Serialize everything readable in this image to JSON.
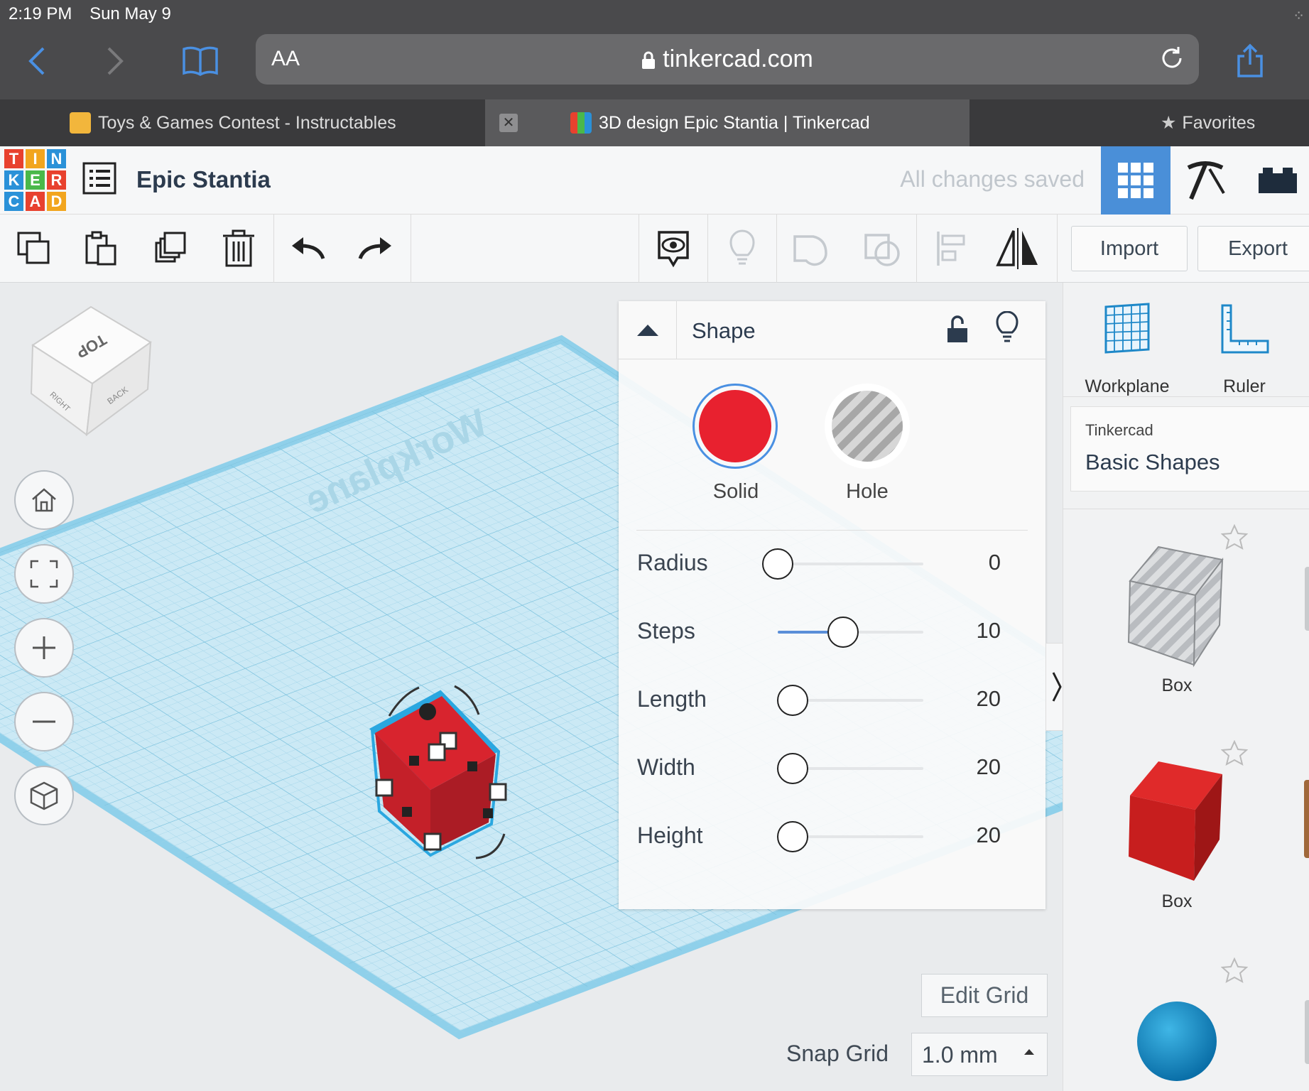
{
  "status_bar": {
    "time": "2:19 PM",
    "date": "Sun May 9"
  },
  "browser": {
    "text_size_label": "AA",
    "url": "tinkercad.com",
    "tabs": [
      {
        "title": "Toys & Games Contest - Instructables",
        "active": false
      },
      {
        "title": "3D design Epic Stantia | Tinkercad",
        "active": true
      }
    ],
    "favorites_label": "Favorites"
  },
  "app": {
    "logo_letters": [
      "T",
      "I",
      "N",
      "K",
      "E",
      "R",
      "C",
      "A",
      "D"
    ],
    "logo_colors": [
      "#e8412e",
      "#f2a51e",
      "#2a91d8",
      "#2a91d8",
      "#4ab84a",
      "#e8412e",
      "#2a91d8",
      "#e8412e",
      "#f2a51e"
    ],
    "design_name": "Epic Stantia",
    "save_status": "All changes saved",
    "import_label": "Import",
    "export_label": "Export"
  },
  "viewcube": {
    "top": "TOP",
    "right": "RIGHT",
    "back": "BACK"
  },
  "workplane_label": "Workplane",
  "inspector": {
    "title": "Shape",
    "solid_label": "Solid",
    "hole_label": "Hole",
    "solid_color": "#e8212f",
    "params": [
      {
        "label": "Radius",
        "value": "0",
        "fraction": 0.0
      },
      {
        "label": "Steps",
        "value": "10",
        "fraction": 0.45
      },
      {
        "label": "Length",
        "value": "20",
        "fraction": 0.1
      },
      {
        "label": "Width",
        "value": "20",
        "fraction": 0.1
      },
      {
        "label": "Height",
        "value": "20",
        "fraction": 0.1
      }
    ]
  },
  "grid_controls": {
    "edit_grid_label": "Edit Grid",
    "snap_grid_label": "Snap Grid",
    "snap_grid_value": "1.0 mm"
  },
  "right_panel": {
    "workplane_label": "Workplane",
    "ruler_label": "Ruler",
    "library_source": "Tinkercad",
    "library_name": "Basic Shapes",
    "shapes": [
      {
        "label": "Box",
        "kind": "hole-box"
      },
      {
        "label": "Box",
        "kind": "red-box"
      },
      {
        "label": "",
        "kind": "sphere"
      }
    ]
  }
}
